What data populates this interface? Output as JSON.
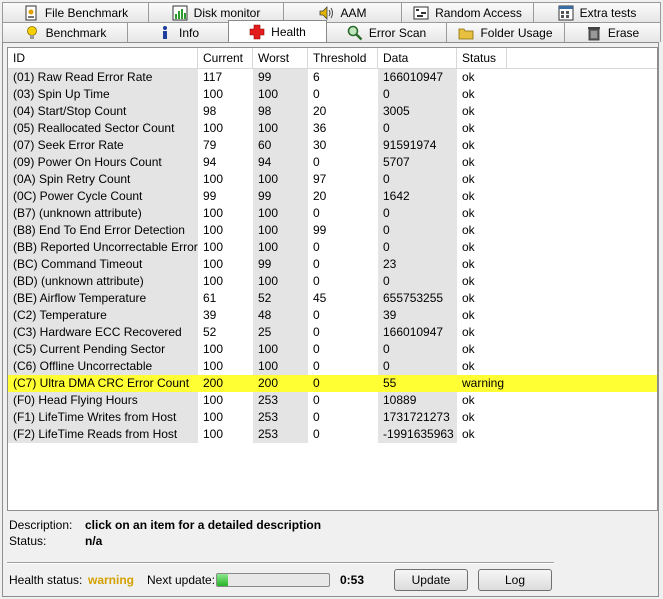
{
  "tabs_row1": [
    {
      "label": "File Benchmark",
      "icon": "file-benchmark-icon"
    },
    {
      "label": "Disk monitor",
      "icon": "disk-monitor-icon"
    },
    {
      "label": "AAM",
      "icon": "speaker-icon"
    },
    {
      "label": "Random Access",
      "icon": "random-access-icon"
    },
    {
      "label": "Extra tests",
      "icon": "extra-tests-icon"
    }
  ],
  "tabs_row2": [
    {
      "label": "Benchmark",
      "icon": "lightbulb-icon"
    },
    {
      "label": "Info",
      "icon": "info-icon"
    },
    {
      "label": "Health",
      "icon": "health-cross-icon"
    },
    {
      "label": "Error Scan",
      "icon": "magnifier-icon"
    },
    {
      "label": "Folder Usage",
      "icon": "folder-icon"
    },
    {
      "label": "Erase",
      "icon": "trash-icon"
    }
  ],
  "table": {
    "columns": [
      "ID",
      "Current",
      "Worst",
      "Threshold",
      "Data",
      "Status"
    ],
    "rows": [
      [
        "(01) Raw Read Error Rate",
        "117",
        "99",
        "6",
        "166010947",
        "ok"
      ],
      [
        "(03) Spin Up Time",
        "100",
        "100",
        "0",
        "0",
        "ok"
      ],
      [
        "(04) Start/Stop Count",
        "98",
        "98",
        "20",
        "3005",
        "ok"
      ],
      [
        "(05) Reallocated Sector Count",
        "100",
        "100",
        "36",
        "0",
        "ok"
      ],
      [
        "(07) Seek Error Rate",
        "79",
        "60",
        "30",
        "91591974",
        "ok"
      ],
      [
        "(09) Power On Hours Count",
        "94",
        "94",
        "0",
        "5707",
        "ok"
      ],
      [
        "(0A) Spin Retry Count",
        "100",
        "100",
        "97",
        "0",
        "ok"
      ],
      [
        "(0C) Power Cycle Count",
        "99",
        "99",
        "20",
        "1642",
        "ok"
      ],
      [
        "(B7) (unknown attribute)",
        "100",
        "100",
        "0",
        "0",
        "ok"
      ],
      [
        "(B8) End To End Error Detection",
        "100",
        "100",
        "99",
        "0",
        "ok"
      ],
      [
        "(BB) Reported Uncorrectable Errors",
        "100",
        "100",
        "0",
        "0",
        "ok"
      ],
      [
        "(BC) Command Timeout",
        "100",
        "99",
        "0",
        "23",
        "ok"
      ],
      [
        "(BD) (unknown attribute)",
        "100",
        "100",
        "0",
        "0",
        "ok"
      ],
      [
        "(BE) Airflow Temperature",
        "61",
        "52",
        "45",
        "655753255",
        "ok"
      ],
      [
        "(C2) Temperature",
        "39",
        "48",
        "0",
        "39",
        "ok"
      ],
      [
        "(C3) Hardware ECC Recovered",
        "52",
        "25",
        "0",
        "166010947",
        "ok"
      ],
      [
        "(C5) Current Pending Sector",
        "100",
        "100",
        "0",
        "0",
        "ok"
      ],
      [
        "(C6) Offline Uncorrectable",
        "100",
        "100",
        "0",
        "0",
        "ok"
      ],
      [
        "(C7) Ultra DMA CRC Error Count",
        "200",
        "200",
        "0",
        "55",
        "warning"
      ],
      [
        "(F0) Head Flying Hours",
        "100",
        "253",
        "0",
        "10889",
        "ok"
      ],
      [
        "(F1) LifeTime Writes from Host",
        "100",
        "253",
        "0",
        "1731721273",
        "ok"
      ],
      [
        "(F2) LifeTime Reads from Host",
        "100",
        "253",
        "0",
        "-1991635963",
        "ok"
      ]
    ]
  },
  "description": {
    "label": "Description:",
    "value": "click on an item for a detailed description"
  },
  "status_line": {
    "label": "Status:",
    "value": "n/a"
  },
  "health": {
    "label": "Health status:",
    "value": "warning",
    "next_update_label": "Next update:",
    "progress": 0.1,
    "countdown": "0:53",
    "update_button": "Update",
    "log_button": "Log"
  },
  "colors": {
    "warning_row": "#ffff33",
    "warning_text": "#d4a000",
    "progress": "#27b327"
  }
}
